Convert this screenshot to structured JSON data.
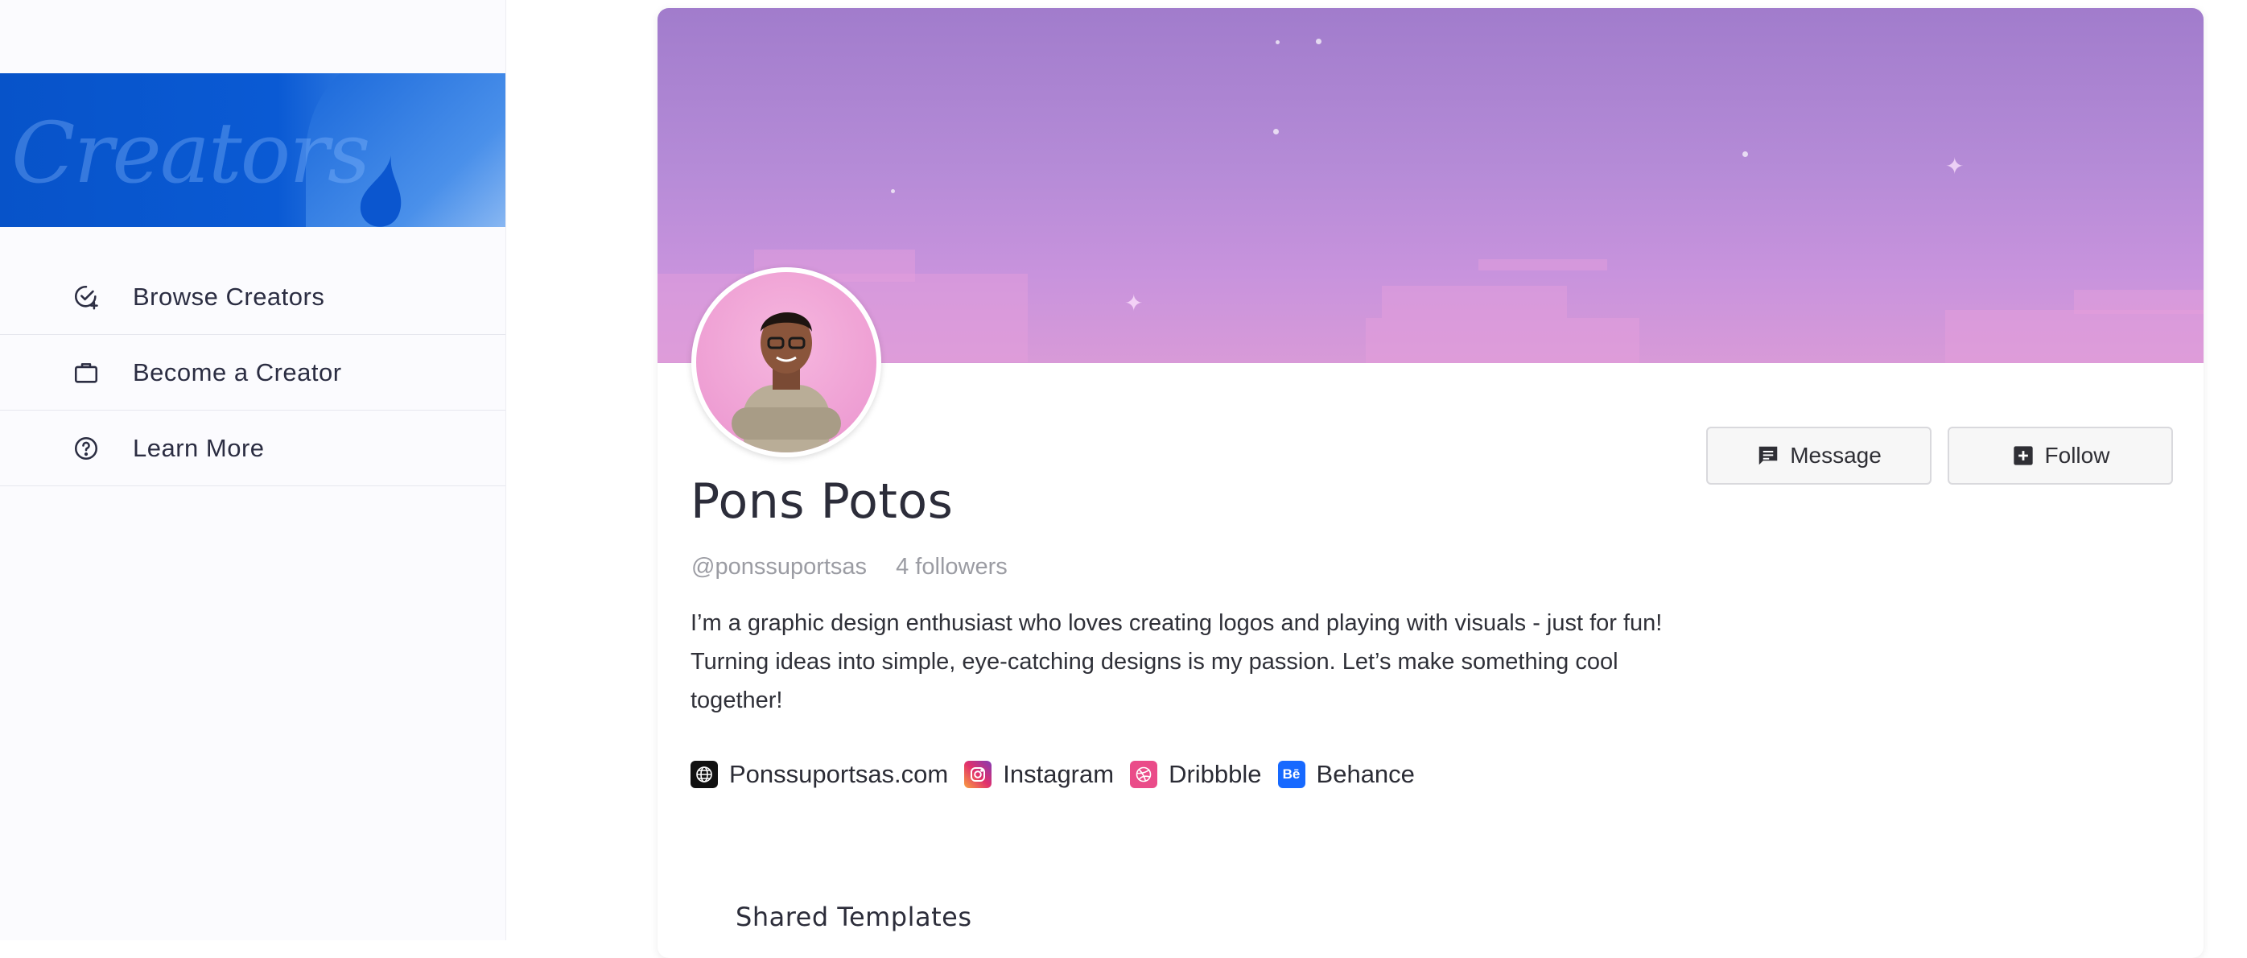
{
  "sidebar": {
    "banner_text": "Creators",
    "items": [
      {
        "label": "Browse Creators",
        "icon": "check-badge-icon"
      },
      {
        "label": "Become a Creator",
        "icon": "briefcase-icon"
      },
      {
        "label": "Learn More",
        "icon": "help-circle-icon"
      }
    ]
  },
  "profile": {
    "name": "Pons Potos",
    "handle": "@ponssuportsas",
    "followers": "4 followers",
    "bio": "I’m a graphic design enthusiast who loves creating logos and playing with visuals - just for fun! Turning ideas into simple, eye-catching designs is my passion. Let’s make something cool together!",
    "actions": {
      "message": "Message",
      "follow": "Follow"
    },
    "links": [
      {
        "label": "Ponssuportsas.com",
        "icon": "globe-icon",
        "color": "#111111"
      },
      {
        "label": "Instagram",
        "icon": "instagram-icon",
        "color": "#d6249f"
      },
      {
        "label": "Dribbble",
        "icon": "dribbble-icon",
        "color": "#ea4c89"
      },
      {
        "label": "Behance",
        "icon": "behance-icon",
        "color": "#1769ff",
        "glyph": "Bē"
      }
    ]
  },
  "sections": {
    "shared_templates": "Shared Templates"
  },
  "colors": {
    "accent": "#0a5ad4",
    "cover": "#b58bd7"
  }
}
